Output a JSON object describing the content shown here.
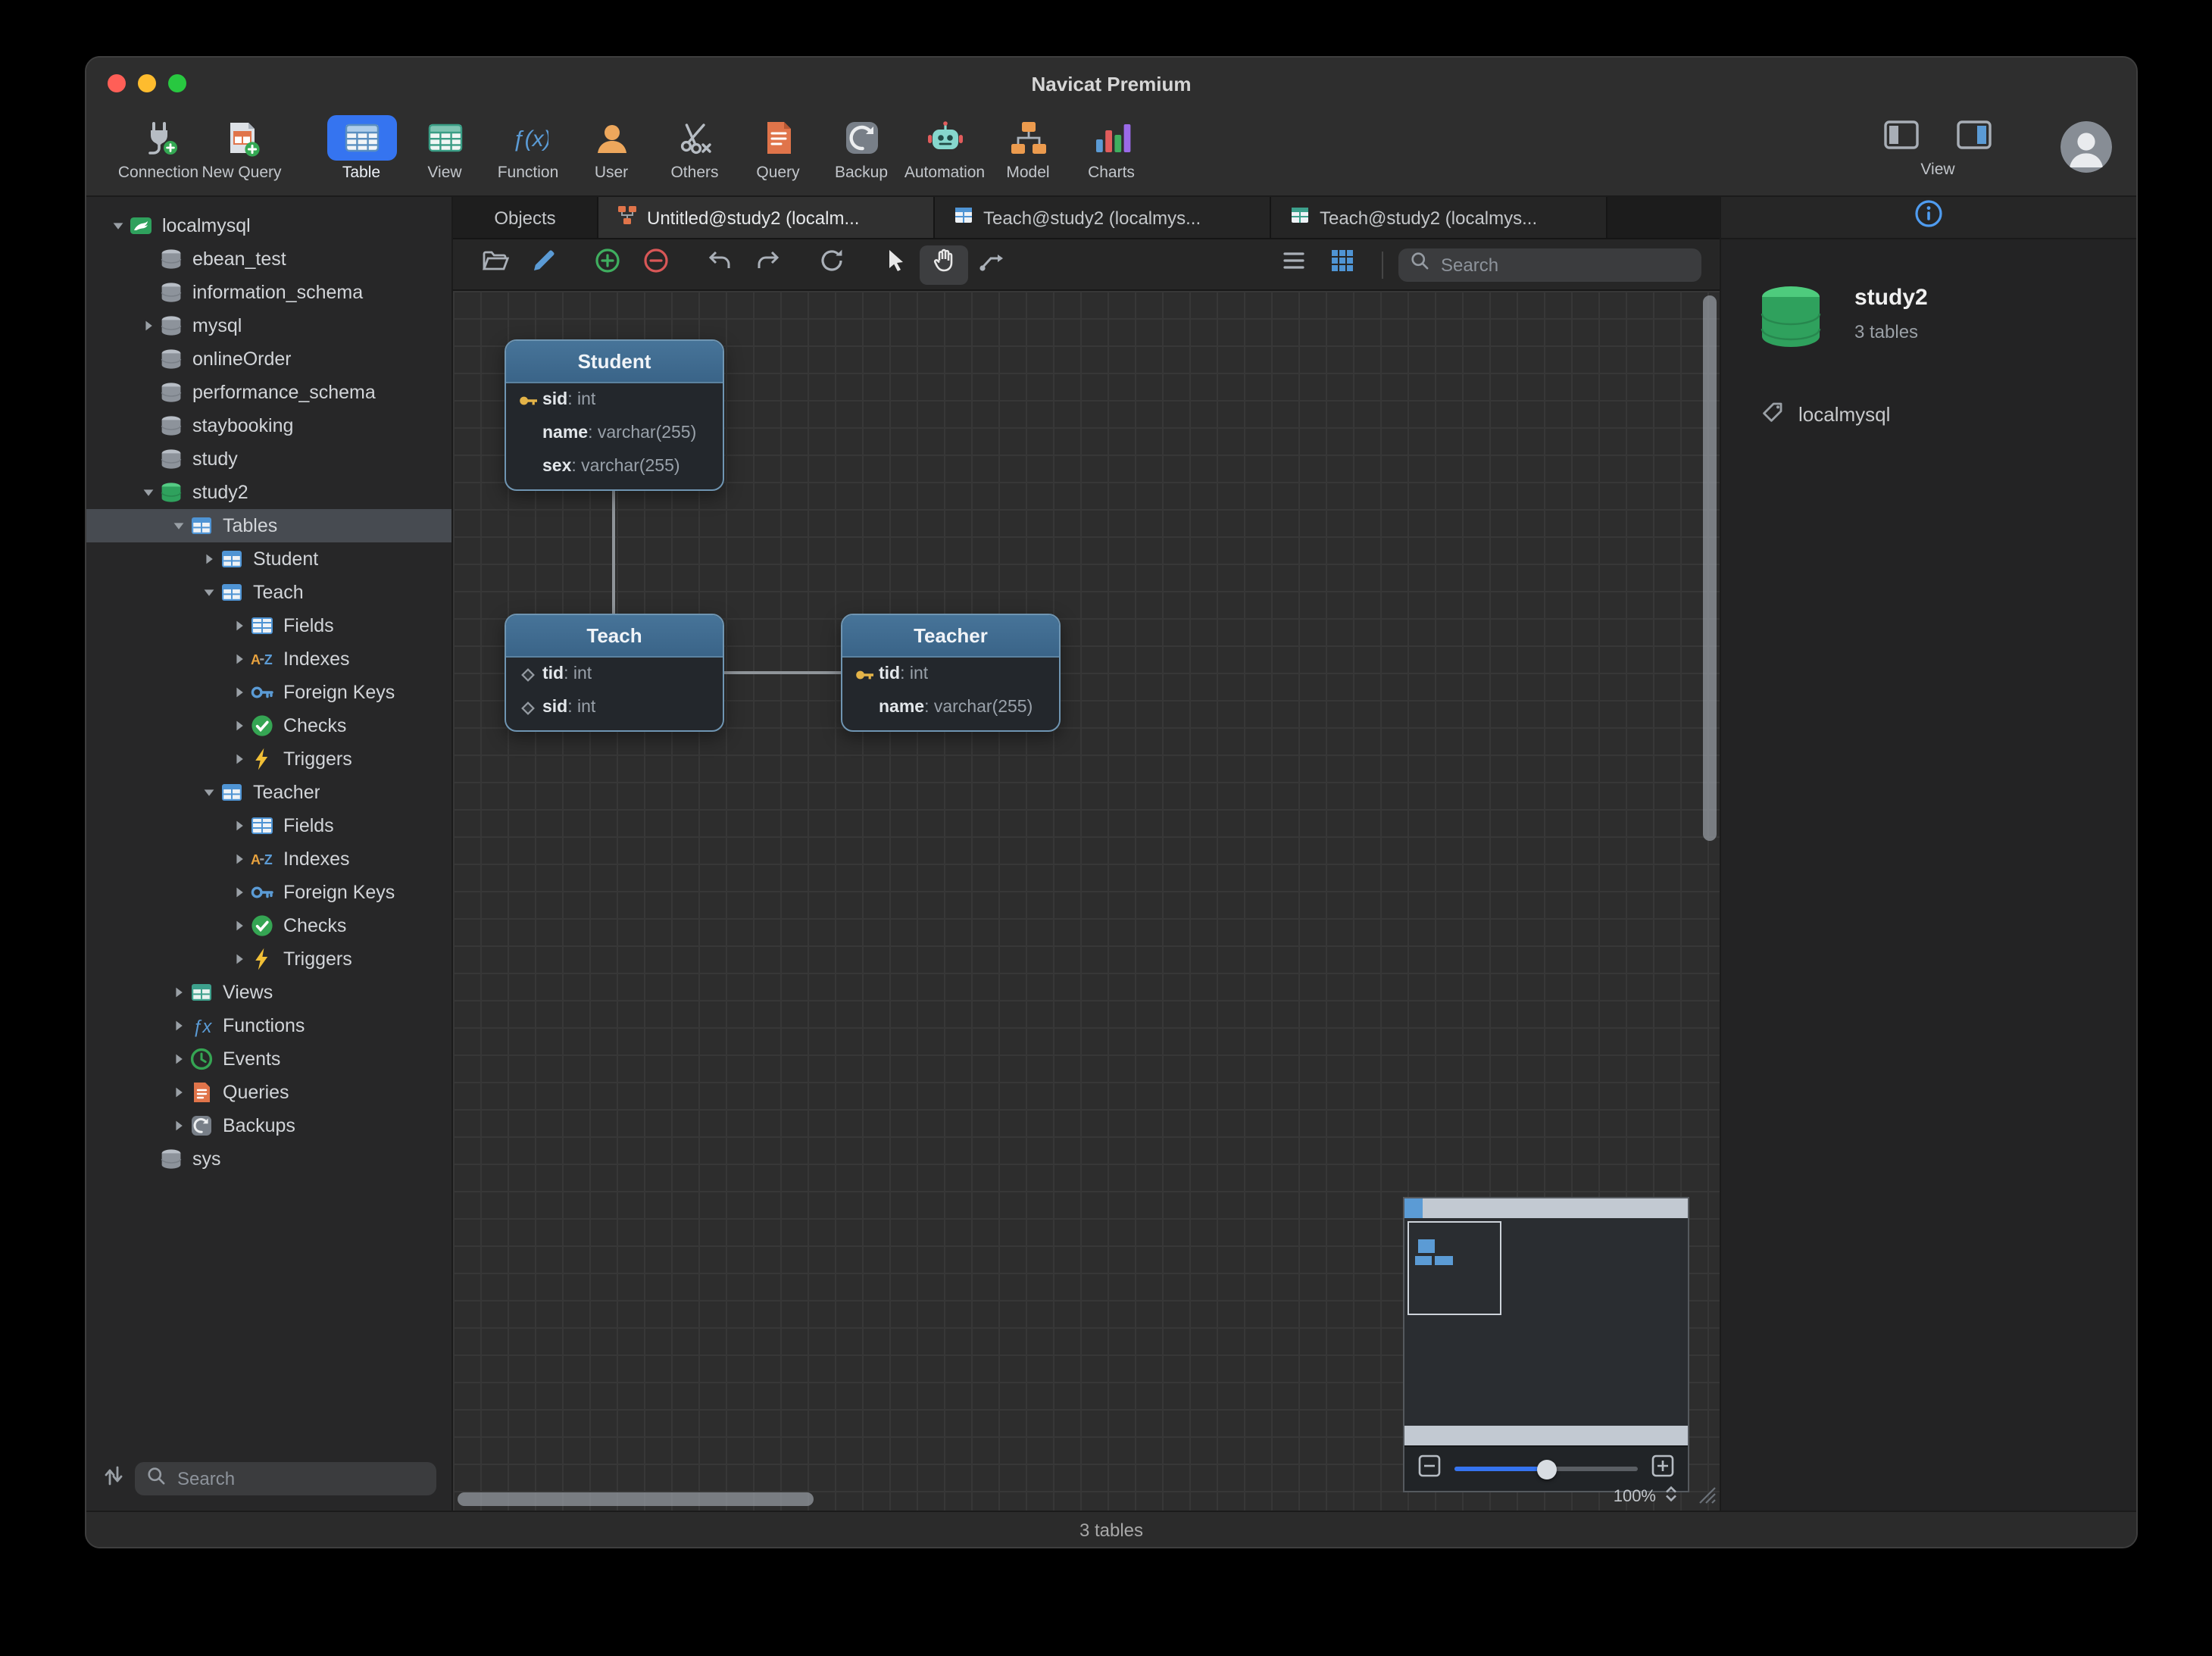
{
  "colors": {
    "accent": "#3574f0",
    "table_header_blue": "#3f6e92",
    "key_gold": "#e3b348",
    "db_green": "#2fa15d"
  },
  "window": {
    "title": "Navicat Premium"
  },
  "toolbar": {
    "items": [
      {
        "label": "Connection",
        "icon": "connection-icon"
      },
      {
        "label": "New Query",
        "icon": "new-query-icon",
        "gap_after": true
      },
      {
        "label": "Table",
        "icon": "table-grid-icon",
        "active": true
      },
      {
        "label": "View",
        "icon": "view-grid-icon"
      },
      {
        "label": "Function",
        "icon": "function-icon"
      },
      {
        "label": "User",
        "icon": "user-icon"
      },
      {
        "label": "Others",
        "icon": "others-icon"
      },
      {
        "label": "Query",
        "icon": "query-icon"
      },
      {
        "label": "Backup",
        "icon": "backup-icon"
      },
      {
        "label": "Automation",
        "icon": "automation-icon"
      },
      {
        "label": "Model",
        "icon": "model-icon"
      },
      {
        "label": "Charts",
        "icon": "charts-icon"
      }
    ],
    "right_label": "View"
  },
  "sidebar": {
    "search_placeholder": "Search",
    "tree": [
      {
        "label": "localmysql",
        "depth": 0,
        "icon": "mysql-connection-icon",
        "chevron": "down"
      },
      {
        "label": "ebean_test",
        "depth": 1,
        "icon": "database-icon"
      },
      {
        "label": "information_schema",
        "depth": 1,
        "icon": "database-icon"
      },
      {
        "label": "mysql",
        "depth": 1,
        "icon": "database-icon",
        "chevron": "right"
      },
      {
        "label": "onlineOrder",
        "depth": 1,
        "icon": "database-icon"
      },
      {
        "label": "performance_schema",
        "depth": 1,
        "icon": "database-icon"
      },
      {
        "label": "staybooking",
        "depth": 1,
        "icon": "database-icon"
      },
      {
        "label": "study",
        "depth": 1,
        "icon": "database-icon"
      },
      {
        "label": "study2",
        "depth": 1,
        "icon": "database-open-icon",
        "chevron": "down"
      },
      {
        "label": "Tables",
        "depth": 2,
        "icon": "table-icon",
        "chevron": "down",
        "selected": true
      },
      {
        "label": "Student",
        "depth": 3,
        "icon": "table-icon",
        "chevron": "right"
      },
      {
        "label": "Teach",
        "depth": 3,
        "icon": "table-icon",
        "chevron": "down"
      },
      {
        "label": "Fields",
        "depth": 4,
        "icon": "fields-icon",
        "chevron": "right"
      },
      {
        "label": "Indexes",
        "depth": 4,
        "icon": "indexes-icon",
        "chevron": "right"
      },
      {
        "label": "Foreign Keys",
        "depth": 4,
        "icon": "foreign-keys-icon",
        "chevron": "right"
      },
      {
        "label": "Checks",
        "depth": 4,
        "icon": "checks-icon",
        "chevron": "right"
      },
      {
        "label": "Triggers",
        "depth": 4,
        "icon": "triggers-icon",
        "chevron": "right"
      },
      {
        "label": "Teacher",
        "depth": 3,
        "icon": "table-icon",
        "chevron": "down"
      },
      {
        "label": "Fields",
        "depth": 4,
        "icon": "fields-icon",
        "chevron": "right"
      },
      {
        "label": "Indexes",
        "depth": 4,
        "icon": "indexes-icon",
        "chevron": "right"
      },
      {
        "label": "Foreign Keys",
        "depth": 4,
        "icon": "foreign-keys-icon",
        "chevron": "right"
      },
      {
        "label": "Checks",
        "depth": 4,
        "icon": "checks-icon",
        "chevron": "right"
      },
      {
        "label": "Triggers",
        "depth": 4,
        "icon": "triggers-icon",
        "chevron": "right"
      },
      {
        "label": "Views",
        "depth": 2,
        "icon": "views-icon",
        "chevron": "right"
      },
      {
        "label": "Functions",
        "depth": 2,
        "icon": "functions-icon",
        "chevron": "right"
      },
      {
        "label": "Events",
        "depth": 2,
        "icon": "events-icon",
        "chevron": "right"
      },
      {
        "label": "Queries",
        "depth": 2,
        "icon": "queries-icon",
        "chevron": "right"
      },
      {
        "label": "Backups",
        "depth": 2,
        "icon": "backups-icon",
        "chevron": "right"
      },
      {
        "label": "sys",
        "depth": 1,
        "icon": "database-icon"
      }
    ]
  },
  "tabs": [
    {
      "label": "Objects",
      "kind": "objects"
    },
    {
      "label": "Untitled@study2 (localm...",
      "icon": "model-file-icon",
      "active": true
    },
    {
      "label": "Teach@study2 (localmys...",
      "icon": "table-file-icon"
    },
    {
      "label": "Teach@study2 (localmys...",
      "icon": "table-file-icon-teal"
    }
  ],
  "canvas_toolbar": {
    "search_placeholder": "Search"
  },
  "diagram": {
    "tables": [
      {
        "name": "Student",
        "fields": [
          {
            "name": "sid",
            "type": "int",
            "icon": "key"
          },
          {
            "name": "name",
            "type": "varchar(255)"
          },
          {
            "name": "sex",
            "type": "varchar(255)"
          }
        ]
      },
      {
        "name": "Teach",
        "fields": [
          {
            "name": "tid",
            "type": "int",
            "icon": "diamond"
          },
          {
            "name": "sid",
            "type": "int",
            "icon": "diamond"
          }
        ]
      },
      {
        "name": "Teacher",
        "fields": [
          {
            "name": "tid",
            "type": "int",
            "icon": "key"
          },
          {
            "name": "name",
            "type": "varchar(255)"
          }
        ]
      }
    ]
  },
  "minimap": {
    "zoom_label": "100%"
  },
  "right_panel": {
    "db_name": "study2",
    "table_count": "3 tables",
    "connection": "localmysql"
  },
  "status_bar": {
    "text": "3 tables"
  }
}
